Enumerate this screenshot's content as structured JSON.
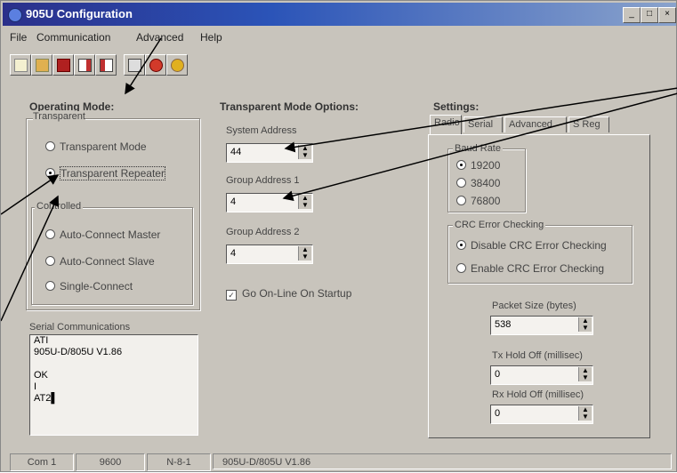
{
  "window": {
    "title": "905U Configuration",
    "buttons": {
      "min": "_",
      "max": "□",
      "close": "×"
    }
  },
  "menu": [
    "File",
    "Communication",
    "Advanced",
    "Help"
  ],
  "toolbar": [
    {
      "name": "new-icon",
      "color": "#e8c24a"
    },
    {
      "name": "open-icon",
      "color": "#d7a23b"
    },
    {
      "name": "save-icon",
      "color": "#b02020"
    },
    {
      "name": "read-icon",
      "color": "#c03030"
    },
    {
      "name": "write-icon",
      "color": "#c03030"
    },
    {
      "name": "terminal-icon",
      "color": "#888888"
    },
    {
      "name": "stop-icon",
      "color": "#d23a2a"
    },
    {
      "name": "help-icon",
      "color": "#e0b020"
    }
  ],
  "operating_mode": {
    "title": "Operating Mode:",
    "transparent_group": "Transparent",
    "transparent_mode": "Transparent Mode",
    "transparent_repeater": "Transparent Repeater",
    "controlled_group": "Controlled",
    "auto_connect_master": "Auto-Connect Master",
    "auto_connect_slave": "Auto-Connect Slave",
    "single_connect": "Single-Connect"
  },
  "serial_comms": {
    "label": "Serial Communications",
    "lines": [
      "ATI",
      "905U-D/805U V1.86",
      "",
      "OK",
      "I",
      "AT2▌"
    ]
  },
  "transparent_options": {
    "title": "Transparent Mode Options:",
    "system_address_label": "System Address",
    "system_address": "44",
    "group_address1_label": "Group Address 1",
    "group_address1": "4",
    "group_address2_label": "Group Address 2",
    "group_address2": "4",
    "go_online_label": "Go On-Line On Startup",
    "go_online_checked": true
  },
  "settings": {
    "title": "Settings:",
    "tabs": [
      "Radio",
      "Serial",
      "Advanced",
      "S Reg"
    ],
    "baud_rate_label": "Baud Rate",
    "baud_rates": [
      "19200",
      "38400",
      "76800"
    ],
    "crc_label": "CRC Error Checking",
    "crc_disable": "Disable CRC Error Checking",
    "crc_enable": "Enable CRC Error Checking",
    "packet_size_label": "Packet Size (bytes)",
    "packet_size": "538",
    "tx_hold_label": "Tx Hold Off (millisec)",
    "tx_hold": "0",
    "rx_hold_label": "Rx Hold Off (millisec)",
    "rx_hold": "0"
  },
  "status": [
    "Com 1",
    "9600",
    "N-8-1",
    "905U-D/805U V1.86"
  ]
}
